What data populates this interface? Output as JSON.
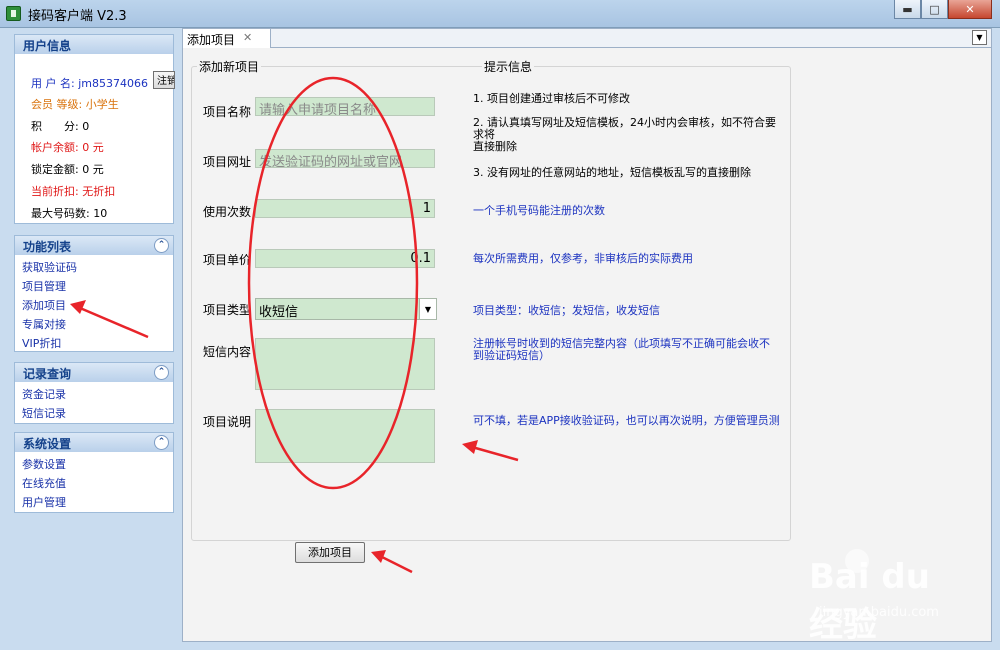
{
  "window": {
    "title": "接码客户端 V2.3",
    "minimize": "▬",
    "maximize": "□",
    "close": "✕"
  },
  "user_panel": {
    "title": "用户信息",
    "username_label": "用 户 名:",
    "username": "jm85374066",
    "register_button": "注销",
    "level_label": "会员 等级:",
    "level": "小学生",
    "points_label": "积　　分:",
    "points": "0",
    "balance_label": "帐户余额:",
    "balance": "0 元",
    "locked_label": "锁定金额:",
    "locked": "0 元",
    "discount_label": "当前折扣:",
    "discount": "无折扣",
    "maxnum_label": "最大号码数:",
    "maxnum": "10"
  },
  "function_panel": {
    "title": "功能列表",
    "items": [
      "获取验证码",
      "项目管理",
      "添加项目",
      "专属对接",
      "VIP折扣"
    ]
  },
  "record_panel": {
    "title": "记录查询",
    "items": [
      "资金记录",
      "短信记录"
    ]
  },
  "settings_panel": {
    "title": "系统设置",
    "items": [
      "参数设置",
      "在线充值",
      "用户管理"
    ]
  },
  "tab": {
    "label": "添加项目",
    "close": "✕"
  },
  "form": {
    "group_title": "添加新项目",
    "name_label": "项目名称",
    "name_placeholder": "请输入申请项目名称",
    "url_label": "项目网址",
    "url_placeholder": "发送验证码的网址或官网",
    "uses_label": "使用次数",
    "uses_value": "1",
    "price_label": "项目单价",
    "price_value": "0.1",
    "type_label": "项目类型",
    "type_value": "收短信",
    "sms_label": "短信内容",
    "desc_label": "项目说明",
    "submit": "添加项目"
  },
  "hints": {
    "title": "提示信息",
    "line1": "1. 项目创建通过审核后不可修改",
    "line2a": "2. 请认真填写网址及短信模板，24小时内会审核，如不符合要",
    "line2b": "求将",
    "line2c": "直接删除",
    "line3": "3. 没有网址的任意网站的地址，短信模板乱写的直接删除",
    "uses_hint": "一个手机号码能注册的次数",
    "price_hint": "每次所需费用，仅参考，非审核后的实际费用",
    "type_hint": "项目类型：收短信；发短信，收发短信",
    "sms_hint_a": "注册帐号时收到的短信完整内容（此项填写不正确可能会收不",
    "sms_hint_b": "到验证码短信）",
    "desc_hint": "可不填，若是APP接收验证码，也可以再次说明，方便管理员测"
  },
  "watermark": {
    "brand": "Bai du 经验",
    "url": "jingyan.baidu.com"
  },
  "colors": {
    "annotation": "#e8242a",
    "field_bg": "#cfe8cf",
    "link": "#1932a8",
    "panel_head": "#15428b"
  }
}
